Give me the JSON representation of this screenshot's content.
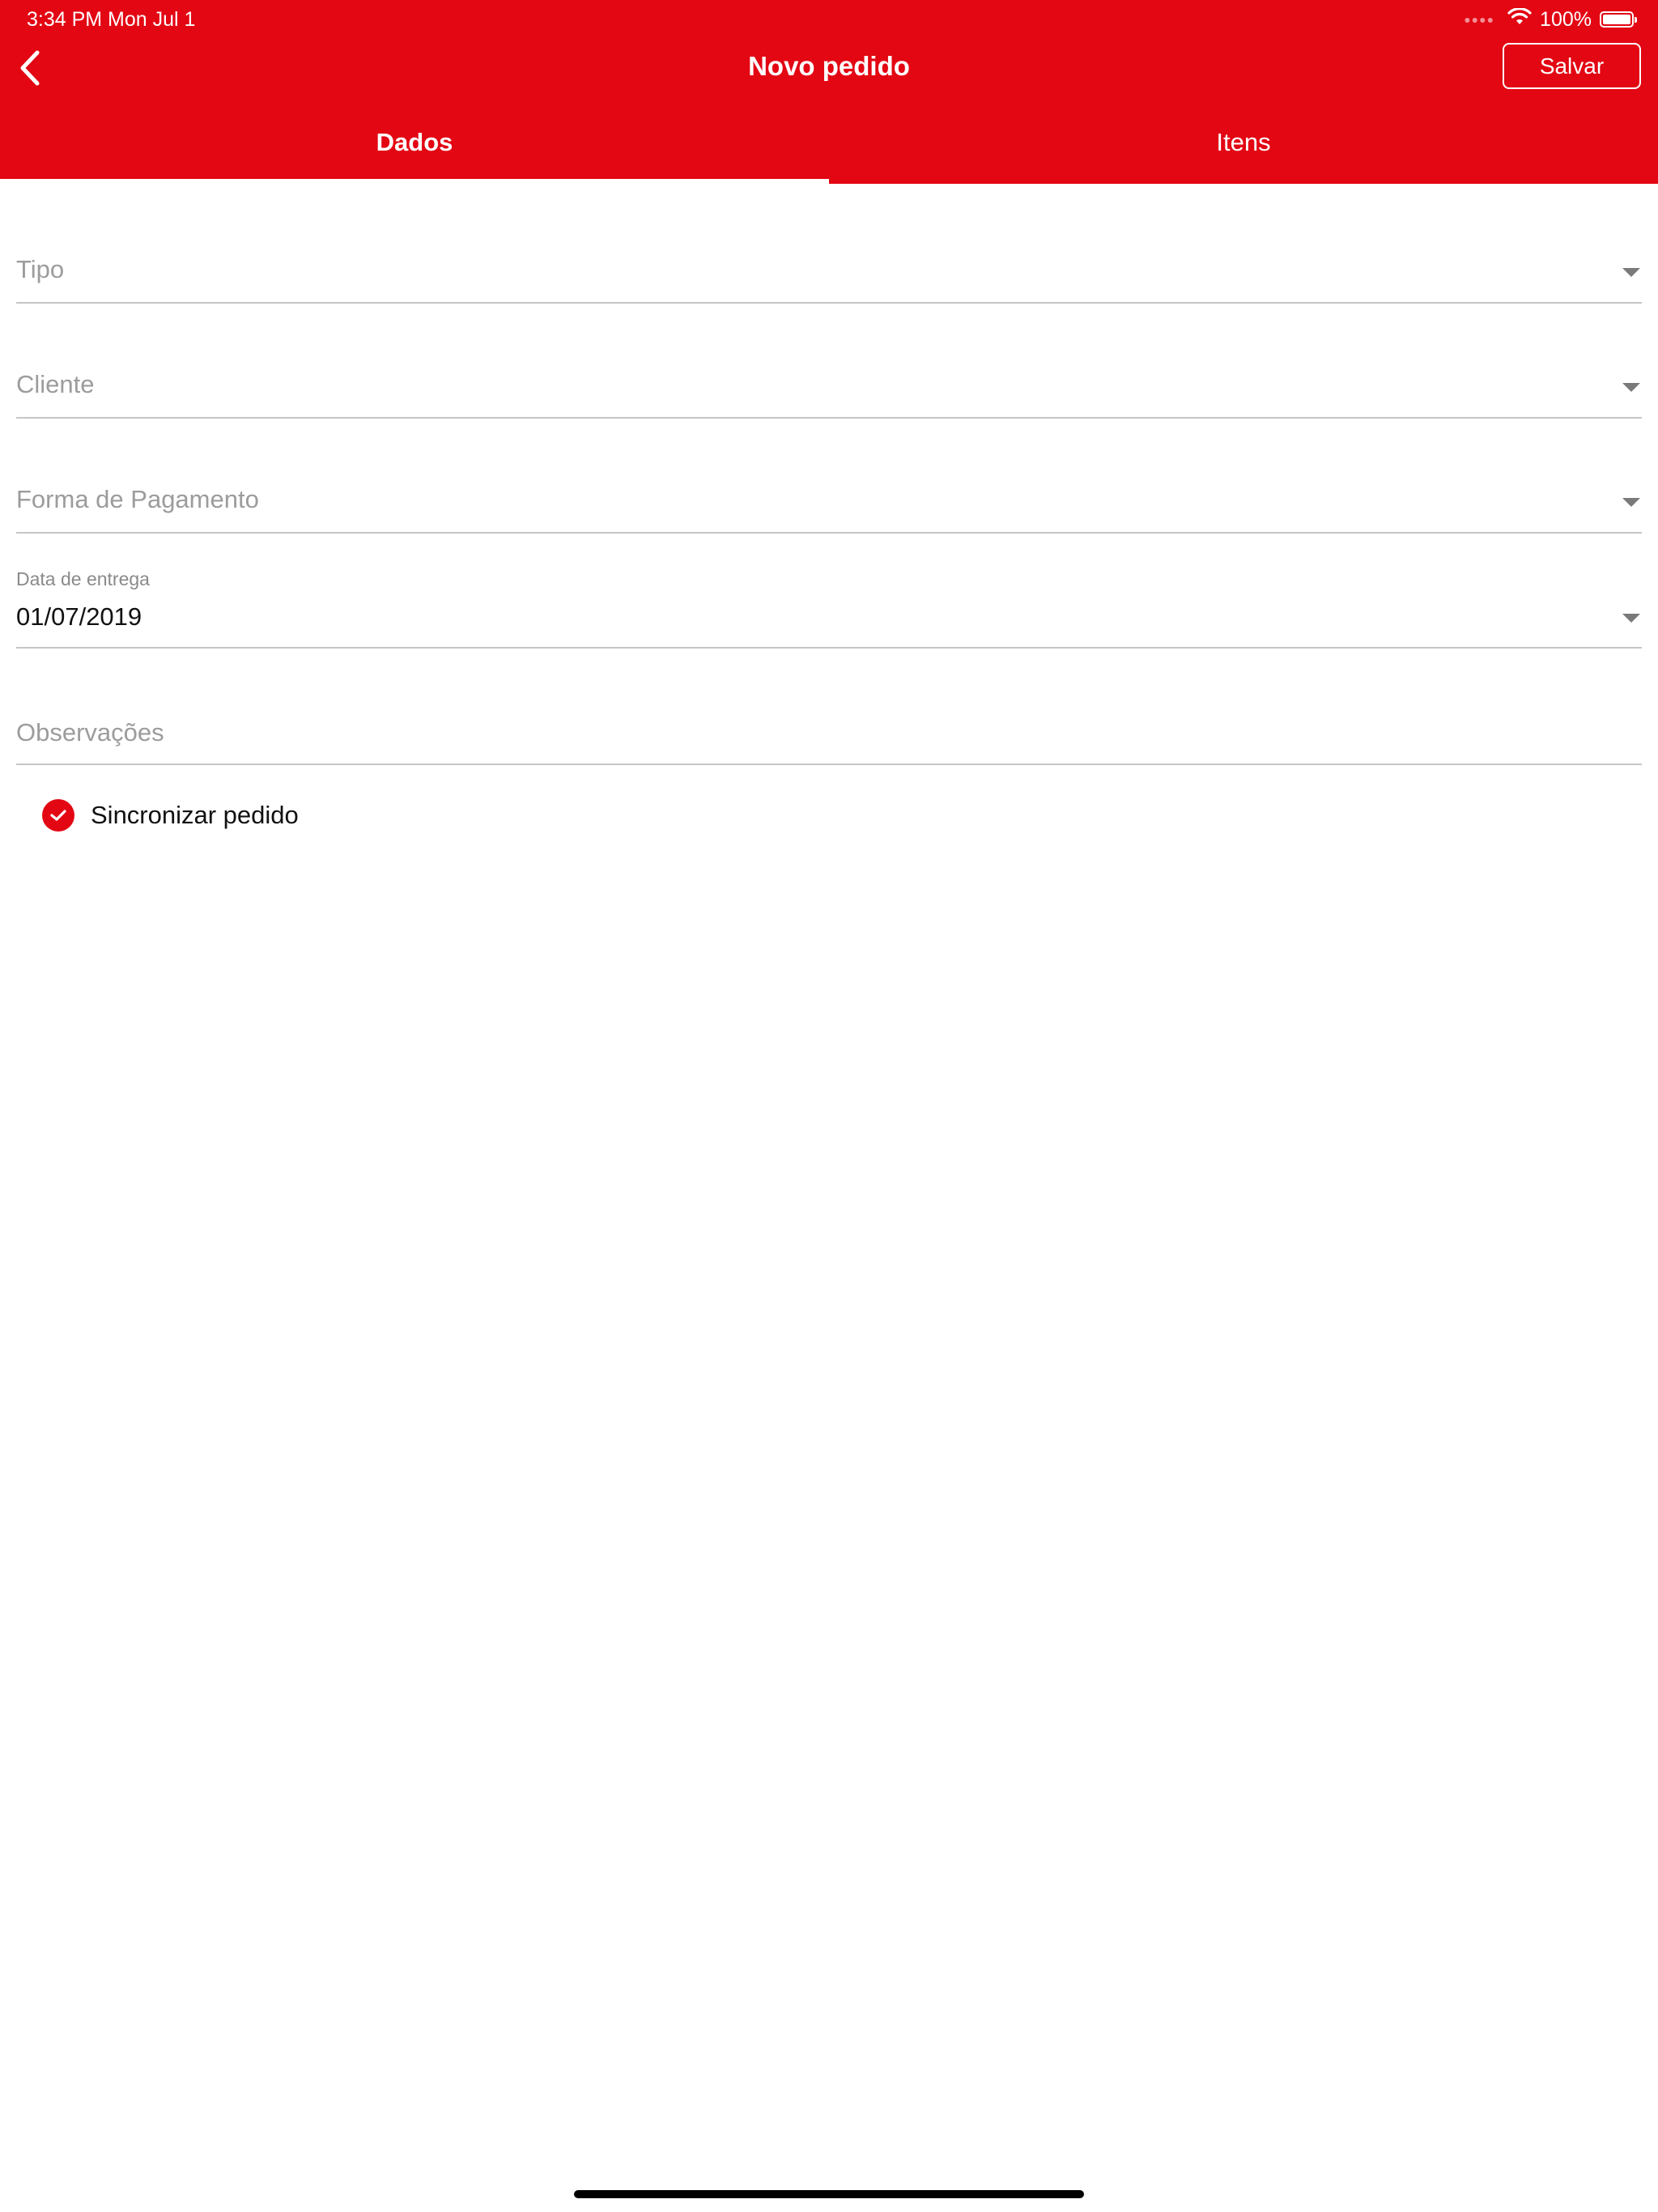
{
  "status_bar": {
    "time": "3:34 PM   Mon Jul 1",
    "battery": "100%"
  },
  "header": {
    "title": "Novo pedido",
    "save_label": "Salvar"
  },
  "tabs": [
    {
      "label": "Dados",
      "active": true
    },
    {
      "label": "Itens",
      "active": false
    }
  ],
  "form": {
    "tipo": {
      "placeholder": "Tipo"
    },
    "cliente": {
      "placeholder": "Cliente"
    },
    "forma_pagamento": {
      "placeholder": "Forma de Pagamento"
    },
    "data_entrega": {
      "label": "Data de entrega",
      "value": "01/07/2019"
    },
    "observacoes": {
      "placeholder": "Observações"
    },
    "sincronizar": {
      "label": "Sincronizar pedido",
      "checked": true
    }
  },
  "colors": {
    "accent": "#e30613",
    "divider": "#c6c6c6",
    "placeholder": "#9c9c9c"
  },
  "icons": [
    "back-chevron-icon",
    "wifi-icon",
    "battery-icon",
    "dropdown-caret-icon",
    "check-icon"
  ]
}
